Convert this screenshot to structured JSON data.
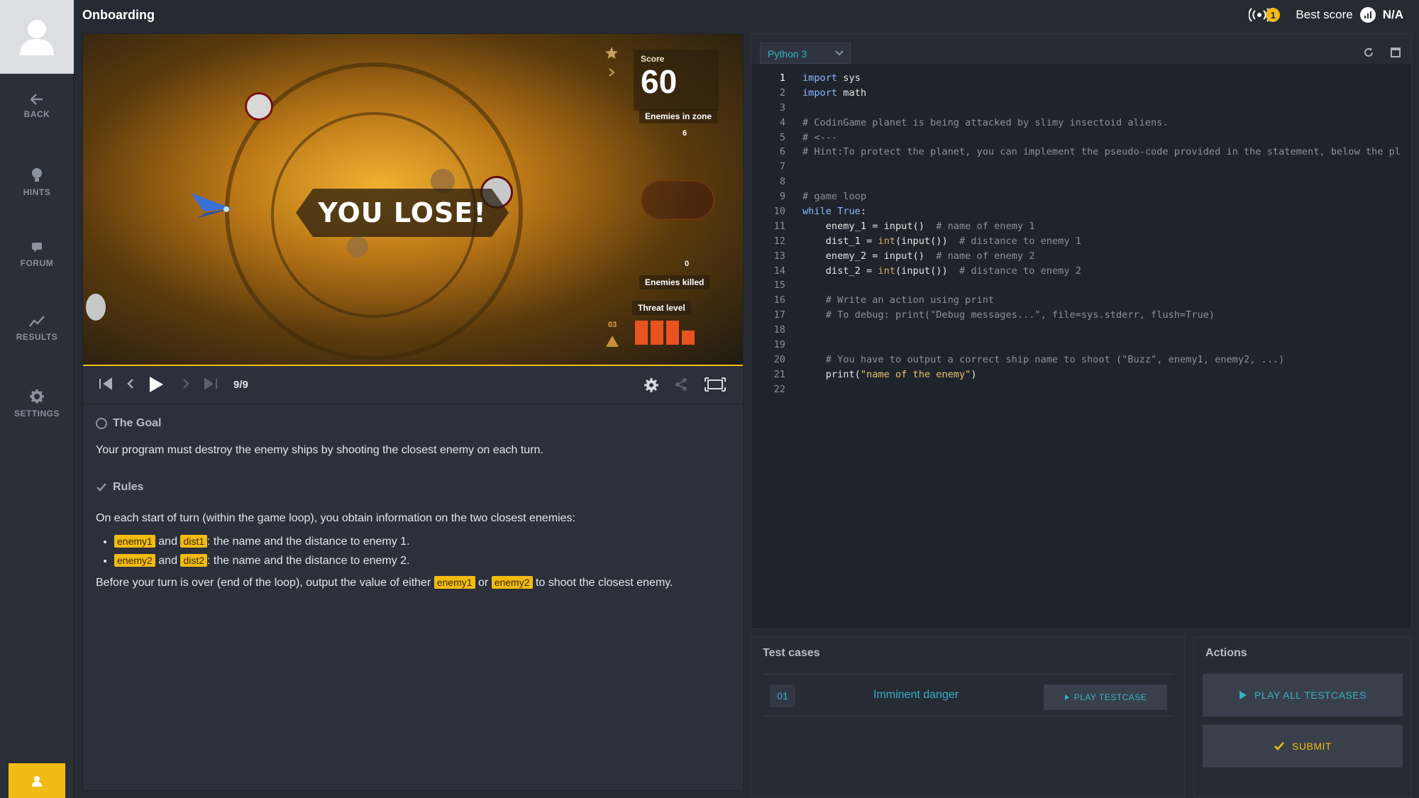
{
  "nav": {
    "back": "BACK",
    "hints": "HINTS",
    "forum": "FORUM",
    "results": "RESULTS",
    "settings": "SETTINGS"
  },
  "header": {
    "title": "Onboarding",
    "notifications": "1",
    "best_score_label": "Best score",
    "best_score_value": "N/A"
  },
  "viewer": {
    "score_label": "Score",
    "score": "60",
    "enemies_in_zone_label": "Enemies in zone",
    "enemies_in_zone": "6",
    "enemies_killed_label": "Enemies killed",
    "enemies_killed": "0",
    "threat_label": "Threat level",
    "threat_value": "03",
    "result": "YOU LOSE!",
    "frame": "9/9"
  },
  "statement": {
    "goal_title": "The Goal",
    "goal_text": "Your program must destroy the enemy ships by shooting the closest enemy on each turn.",
    "rules_title": "Rules",
    "rules_intro": "On each start of turn (within the game loop), you obtain information on the two closest enemies:",
    "b1_v1": "enemy1",
    "b1_and": "and",
    "b1_v2": "dist1",
    "b1_text": ": the name and the distance to enemy 1.",
    "b2_v1": "enemy2",
    "b2_and": "and",
    "b2_v2": "dist2",
    "b2_text": ": the name and the distance to enemy 2.",
    "out_pre": "Before your turn is over (end of the loop), output the value of either",
    "out_v1": "enemy1",
    "out_or": "or",
    "out_v2": "enemy2",
    "out_post": "to shoot the closest enemy."
  },
  "editor": {
    "language": "Python 3",
    "lines": [
      {
        "n": "1",
        "indent": "",
        "parts": [
          {
            "t": "kw",
            "v": "import"
          },
          {
            "t": "",
            "v": " sys"
          }
        ]
      },
      {
        "n": "2",
        "indent": "",
        "parts": [
          {
            "t": "kw",
            "v": "import"
          },
          {
            "t": "",
            "v": " math"
          }
        ]
      },
      {
        "n": "3",
        "indent": "",
        "parts": []
      },
      {
        "n": "4",
        "indent": "",
        "parts": [
          {
            "t": "cm",
            "v": "# CodinGame planet is being attacked by slimy insectoid aliens."
          }
        ]
      },
      {
        "n": "5",
        "indent": "",
        "parts": [
          {
            "t": "cm",
            "v": "# <---"
          }
        ]
      },
      {
        "n": "6",
        "indent": "",
        "parts": [
          {
            "t": "cm",
            "v": "# Hint:To protect the planet, you can implement the pseudo-code provided in the statement, below the pl"
          }
        ]
      },
      {
        "n": "7",
        "indent": "",
        "parts": []
      },
      {
        "n": "8",
        "indent": "",
        "parts": []
      },
      {
        "n": "9",
        "indent": "",
        "parts": [
          {
            "t": "cm",
            "v": "# game loop"
          }
        ]
      },
      {
        "n": "10",
        "indent": "",
        "parts": [
          {
            "t": "kw",
            "v": "while"
          },
          {
            "t": "",
            "v": " "
          },
          {
            "t": "kw",
            "v": "True"
          },
          {
            "t": "",
            "v": ":"
          }
        ]
      },
      {
        "n": "11",
        "indent": "    ",
        "parts": [
          {
            "t": "",
            "v": "enemy_1 = input()  "
          },
          {
            "t": "cm",
            "v": "# name of enemy 1"
          }
        ]
      },
      {
        "n": "12",
        "indent": "    ",
        "parts": [
          {
            "t": "",
            "v": "dist_1 = "
          },
          {
            "t": "fn",
            "v": "int"
          },
          {
            "t": "",
            "v": "(input())  "
          },
          {
            "t": "cm",
            "v": "# distance to enemy 1"
          }
        ]
      },
      {
        "n": "13",
        "indent": "    ",
        "parts": [
          {
            "t": "",
            "v": "enemy_2 = input()  "
          },
          {
            "t": "cm",
            "v": "# name of enemy 2"
          }
        ]
      },
      {
        "n": "14",
        "indent": "    ",
        "parts": [
          {
            "t": "",
            "v": "dist_2 = "
          },
          {
            "t": "fn",
            "v": "int"
          },
          {
            "t": "",
            "v": "(input())  "
          },
          {
            "t": "cm",
            "v": "# distance to enemy 2"
          }
        ]
      },
      {
        "n": "15",
        "indent": "",
        "parts": []
      },
      {
        "n": "16",
        "indent": "    ",
        "parts": [
          {
            "t": "cm",
            "v": "# Write an action using print"
          }
        ]
      },
      {
        "n": "17",
        "indent": "    ",
        "parts": [
          {
            "t": "cm",
            "v": "# To debug: print(\"Debug messages...\", file=sys.stderr, flush=True)"
          }
        ]
      },
      {
        "n": "18",
        "indent": "",
        "parts": []
      },
      {
        "n": "19",
        "indent": "",
        "parts": []
      },
      {
        "n": "20",
        "indent": "    ",
        "parts": [
          {
            "t": "cm",
            "v": "# You have to output a correct ship name to shoot (\"Buzz\", enemy1, enemy2, ...)"
          }
        ]
      },
      {
        "n": "21",
        "indent": "    ",
        "parts": [
          {
            "t": "",
            "v": "print("
          },
          {
            "t": "st",
            "v": "\"name of the enemy\""
          },
          {
            "t": "",
            "v": ")"
          }
        ]
      },
      {
        "n": "22",
        "indent": "",
        "parts": []
      }
    ]
  },
  "testcases": {
    "title": "Test cases",
    "items": [
      {
        "num": "01",
        "name": "Imminent danger",
        "button": "PLAY TESTCASE"
      }
    ]
  },
  "actions": {
    "title": "Actions",
    "play_all": "PLAY ALL TESTCASES",
    "submit": "SUBMIT"
  },
  "colors": {
    "accent_yellow": "#f2bb13",
    "accent_cyan": "#36b1c4",
    "background": "#252a33"
  }
}
